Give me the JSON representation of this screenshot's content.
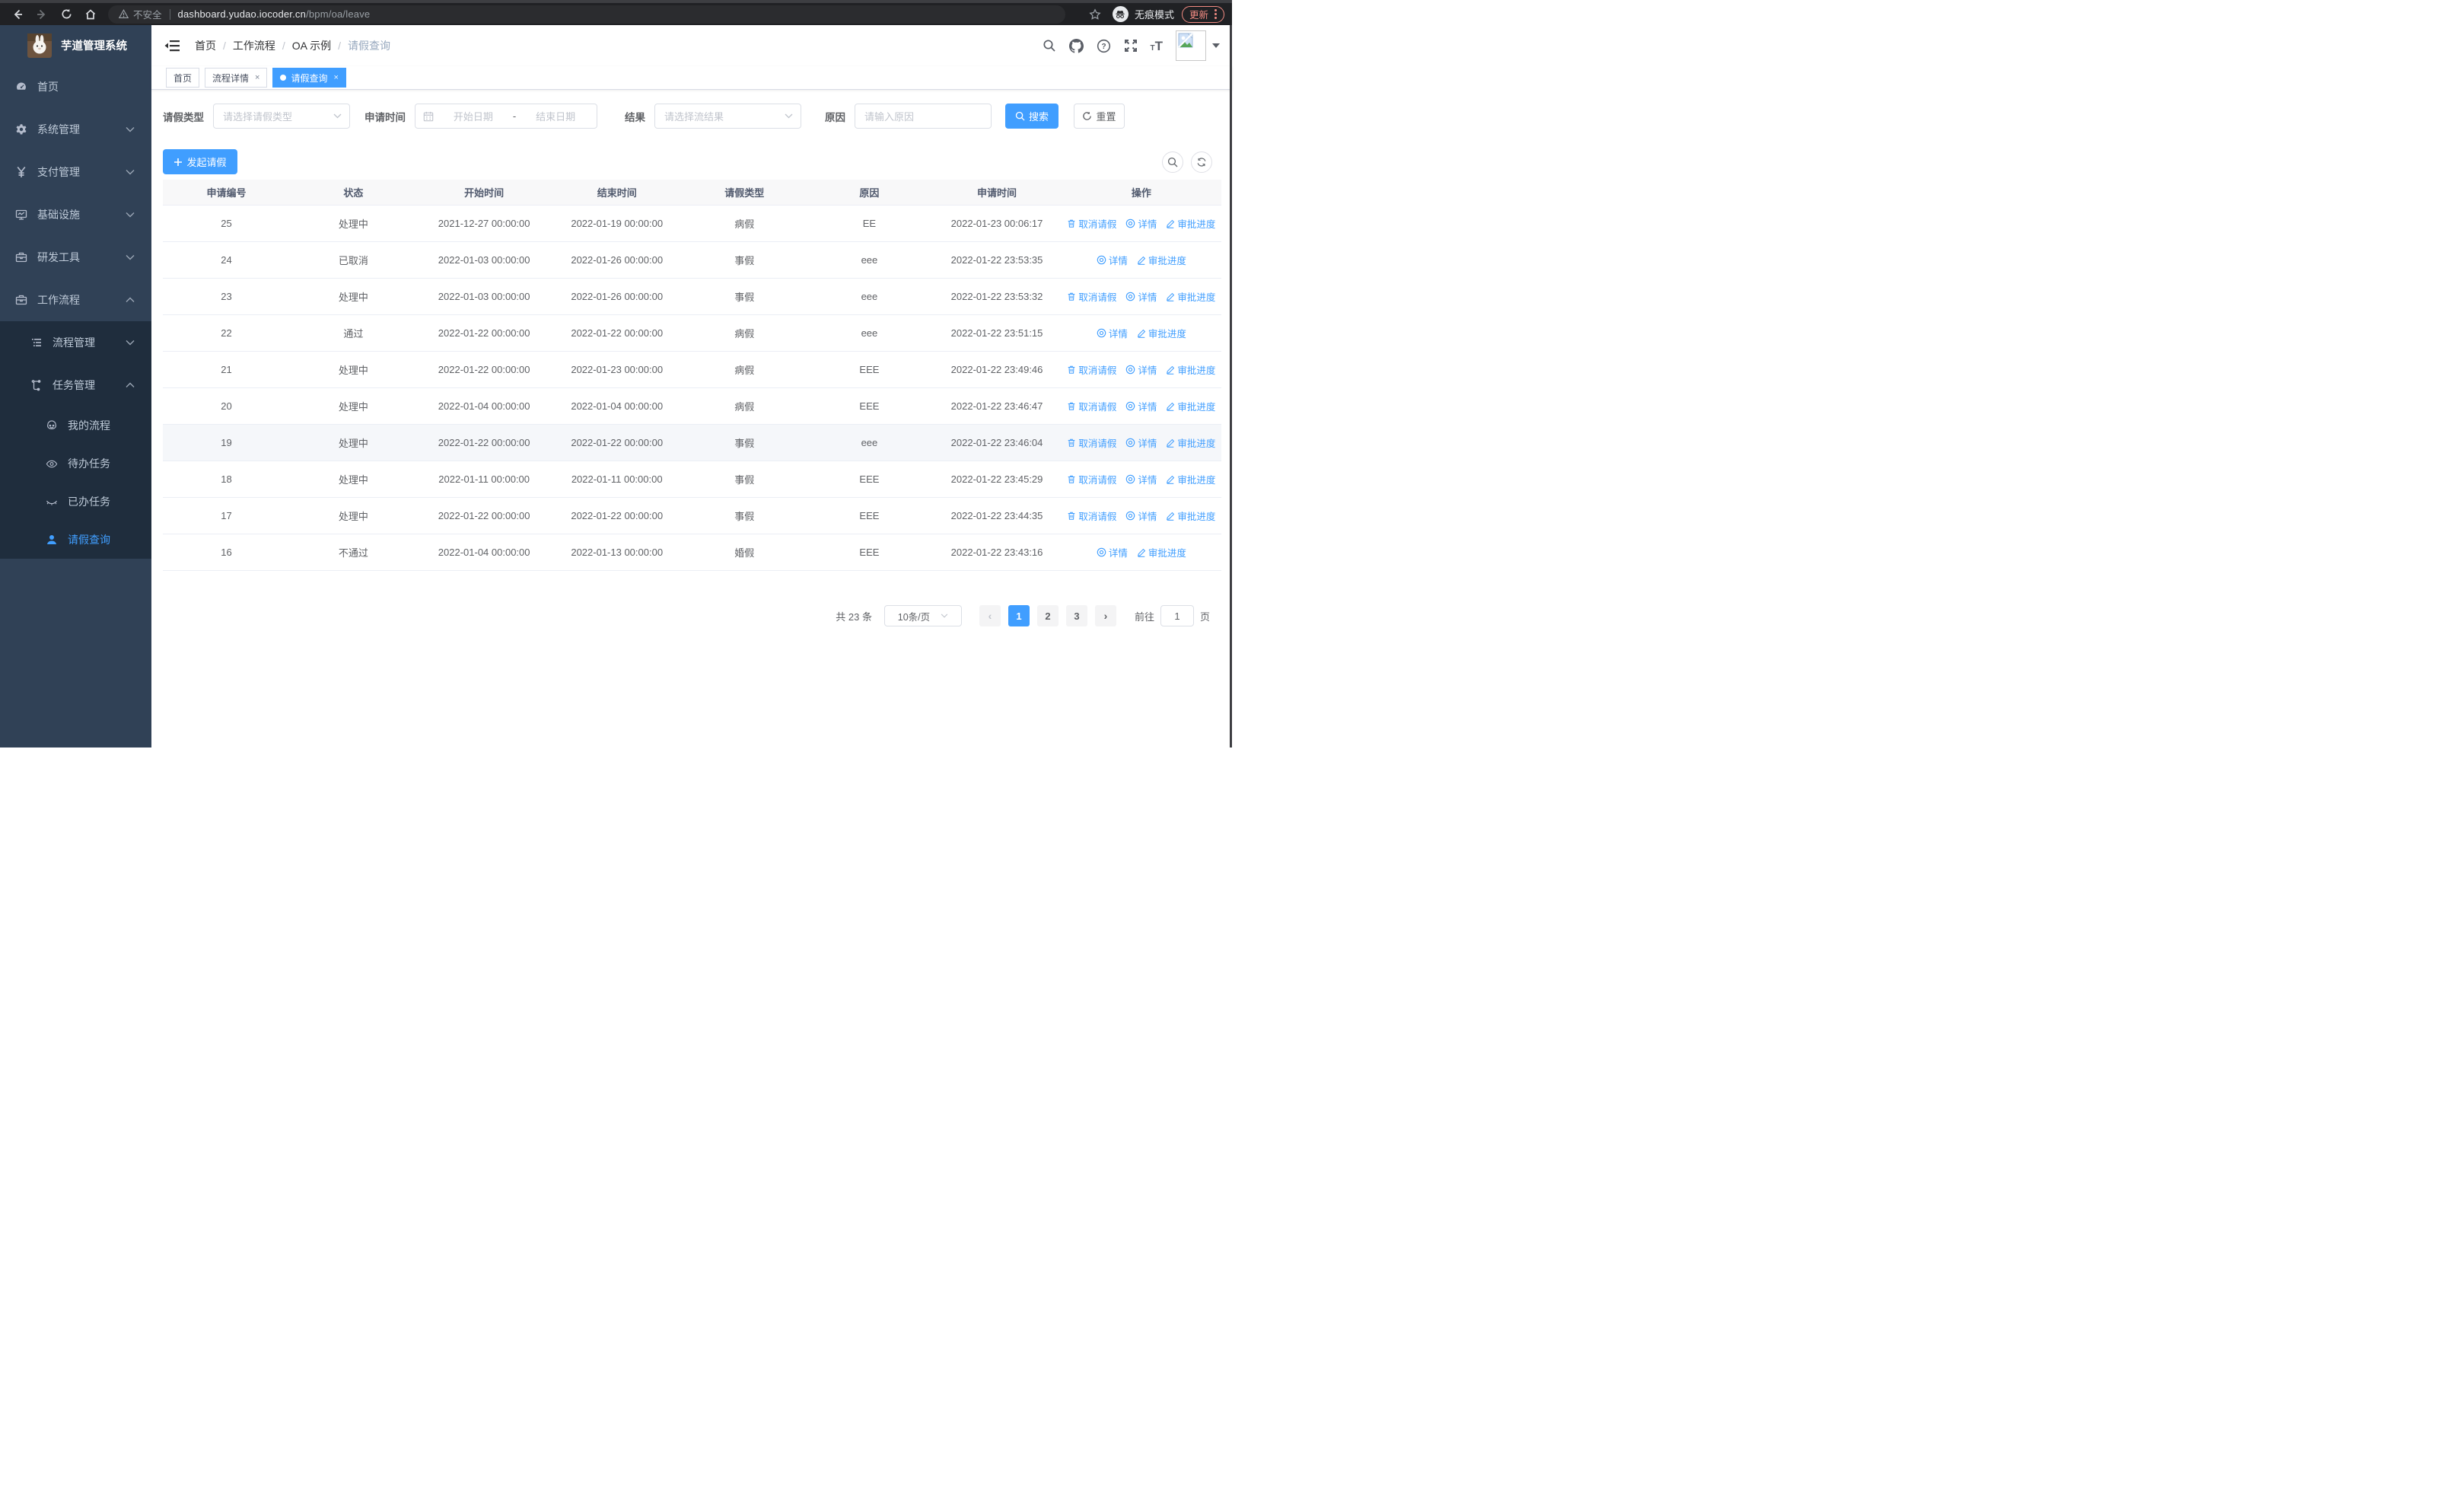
{
  "colors": {
    "primary": "#409eff",
    "sidebar_bg": "#304156",
    "submenu_bg": "#1f2d3d",
    "update_accent": "#f28b82"
  },
  "browser": {
    "security_label": "不安全",
    "url_host": "dashboard.yudao.iocoder.cn",
    "url_path": "/bpm/oa/leave",
    "incognito_label": "无痕模式",
    "update_label": "更新"
  },
  "sidebar": {
    "title": "芋道管理系统",
    "menu": [
      {
        "label": "首页",
        "icon": "dashboard-icon",
        "level": 1,
        "arrow": ""
      },
      {
        "label": "系统管理",
        "icon": "gear-icon",
        "level": 1,
        "arrow": "down"
      },
      {
        "label": "支付管理",
        "icon": "yen-icon",
        "level": 1,
        "arrow": "down"
      },
      {
        "label": "基础设施",
        "icon": "monitor-icon",
        "level": 1,
        "arrow": "down"
      },
      {
        "label": "研发工具",
        "icon": "toolbox-icon",
        "level": 1,
        "arrow": "down"
      },
      {
        "label": "工作流程",
        "icon": "briefcase-icon",
        "level": 1,
        "arrow": "up"
      },
      {
        "label": "流程管理",
        "icon": "list-tree-icon",
        "level": 2,
        "arrow": "down",
        "group": true
      },
      {
        "label": "任务管理",
        "icon": "flow-icon",
        "level": 2,
        "arrow": "up",
        "group": true
      },
      {
        "label": "我的流程",
        "icon": "face-icon",
        "level": 3,
        "group": true
      },
      {
        "label": "待办任务",
        "icon": "eye-icon",
        "level": 3,
        "group": true
      },
      {
        "label": "已办任务",
        "icon": "eye-closed-icon",
        "level": 3,
        "group": true
      },
      {
        "label": "请假查询",
        "icon": "user-icon",
        "level": 3,
        "group": true,
        "active": true
      }
    ]
  },
  "header": {
    "breadcrumb": [
      "首页",
      "工作流程",
      "OA 示例",
      "请假查询"
    ]
  },
  "tabs": [
    {
      "label": "首页",
      "closable": false,
      "active": false
    },
    {
      "label": "流程详情",
      "closable": true,
      "active": false
    },
    {
      "label": "请假查询",
      "closable": true,
      "active": true
    }
  ],
  "filters": {
    "leave_type_label": "请假类型",
    "leave_type_placeholder": "请选择请假类型",
    "apply_time_label": "申请时间",
    "date_start_placeholder": "开始日期",
    "date_separator": "-",
    "date_end_placeholder": "结束日期",
    "result_label": "结果",
    "result_placeholder": "请选择流结果",
    "reason_label": "原因",
    "reason_placeholder": "请输入原因",
    "search_label": "搜索",
    "reset_label": "重置"
  },
  "toolbar": {
    "create_label": "发起请假"
  },
  "table": {
    "columns": [
      "申请编号",
      "状态",
      "开始时间",
      "结束时间",
      "请假类型",
      "原因",
      "申请时间",
      "操作"
    ],
    "action_labels": {
      "cancel": "取消请假",
      "detail": "详情",
      "progress": "审批进度"
    },
    "rows": [
      {
        "id": "25",
        "status": "处理中",
        "start": "2021-12-27 00:00:00",
        "end": "2022-01-19 00:00:00",
        "type": "病假",
        "reason": "EE",
        "applied": "2022-01-23 00:06:17",
        "actions": [
          "cancel",
          "detail",
          "progress"
        ]
      },
      {
        "id": "24",
        "status": "已取消",
        "start": "2022-01-03 00:00:00",
        "end": "2022-01-26 00:00:00",
        "type": "事假",
        "reason": "eee",
        "applied": "2022-01-22 23:53:35",
        "actions": [
          "detail",
          "progress"
        ]
      },
      {
        "id": "23",
        "status": "处理中",
        "start": "2022-01-03 00:00:00",
        "end": "2022-01-26 00:00:00",
        "type": "事假",
        "reason": "eee",
        "applied": "2022-01-22 23:53:32",
        "actions": [
          "cancel",
          "detail",
          "progress"
        ]
      },
      {
        "id": "22",
        "status": "通过",
        "start": "2022-01-22 00:00:00",
        "end": "2022-01-22 00:00:00",
        "type": "病假",
        "reason": "eee",
        "applied": "2022-01-22 23:51:15",
        "actions": [
          "detail",
          "progress"
        ]
      },
      {
        "id": "21",
        "status": "处理中",
        "start": "2022-01-22 00:00:00",
        "end": "2022-01-23 00:00:00",
        "type": "病假",
        "reason": "EEE",
        "applied": "2022-01-22 23:49:46",
        "actions": [
          "cancel",
          "detail",
          "progress"
        ]
      },
      {
        "id": "20",
        "status": "处理中",
        "start": "2022-01-04 00:00:00",
        "end": "2022-01-04 00:00:00",
        "type": "病假",
        "reason": "EEE",
        "applied": "2022-01-22 23:46:47",
        "actions": [
          "cancel",
          "detail",
          "progress"
        ]
      },
      {
        "id": "19",
        "status": "处理中",
        "start": "2022-01-22 00:00:00",
        "end": "2022-01-22 00:00:00",
        "type": "事假",
        "reason": "eee",
        "applied": "2022-01-22 23:46:04",
        "actions": [
          "cancel",
          "detail",
          "progress"
        ],
        "highlighted": true
      },
      {
        "id": "18",
        "status": "处理中",
        "start": "2022-01-11 00:00:00",
        "end": "2022-01-11 00:00:00",
        "type": "事假",
        "reason": "EEE",
        "applied": "2022-01-22 23:45:29",
        "actions": [
          "cancel",
          "detail",
          "progress"
        ]
      },
      {
        "id": "17",
        "status": "处理中",
        "start": "2022-01-22 00:00:00",
        "end": "2022-01-22 00:00:00",
        "type": "事假",
        "reason": "EEE",
        "applied": "2022-01-22 23:44:35",
        "actions": [
          "cancel",
          "detail",
          "progress"
        ]
      },
      {
        "id": "16",
        "status": "不通过",
        "start": "2022-01-04 00:00:00",
        "end": "2022-01-13 00:00:00",
        "type": "婚假",
        "reason": "EEE",
        "applied": "2022-01-22 23:43:16",
        "actions": [
          "detail",
          "progress"
        ]
      }
    ]
  },
  "pagination": {
    "total_text": "共 23 条",
    "page_size": "10条/页",
    "pages": [
      "1",
      "2",
      "3"
    ],
    "current": "1",
    "goto_label": "前往",
    "goto_value": "1",
    "page_unit": "页"
  }
}
